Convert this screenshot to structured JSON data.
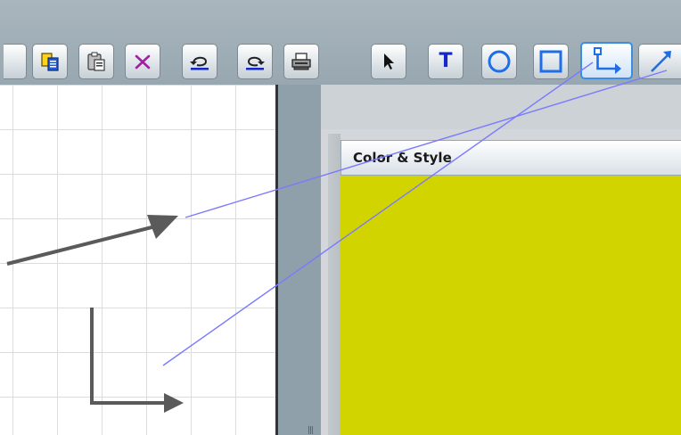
{
  "toolbar": {
    "buttons": [
      {
        "name": "copy",
        "icon": "copy-icon",
        "interactable": true
      },
      {
        "name": "paste",
        "icon": "paste-icon",
        "interactable": true
      },
      {
        "name": "delete",
        "icon": "delete-icon",
        "interactable": true
      },
      {
        "name": "undo",
        "icon": "undo-icon",
        "interactable": true
      },
      {
        "name": "redo",
        "icon": "redo-icon",
        "interactable": true
      },
      {
        "name": "print",
        "icon": "printer-icon",
        "interactable": true
      }
    ],
    "tools": [
      {
        "name": "select-tool",
        "icon": "pointer-arrow-icon",
        "active": false
      },
      {
        "name": "text-tool",
        "icon": "text-icon",
        "glyph": "T",
        "active": false
      },
      {
        "name": "ellipse-tool",
        "icon": "circle-icon",
        "active": false
      },
      {
        "name": "rectangle-tool",
        "icon": "square-icon",
        "active": false
      },
      {
        "name": "elbow-connector-tool",
        "icon": "elbow-connector-icon",
        "active": true
      },
      {
        "name": "line-tool",
        "icon": "diagonal-arrow-icon",
        "active": false
      }
    ]
  },
  "panel": {
    "title": "Color & Style",
    "fill_color": "#d2d400"
  },
  "colors": {
    "accent_blue": "#1428c8",
    "active_border": "#3b8de3",
    "connector_gray": "#5a5a5a"
  }
}
